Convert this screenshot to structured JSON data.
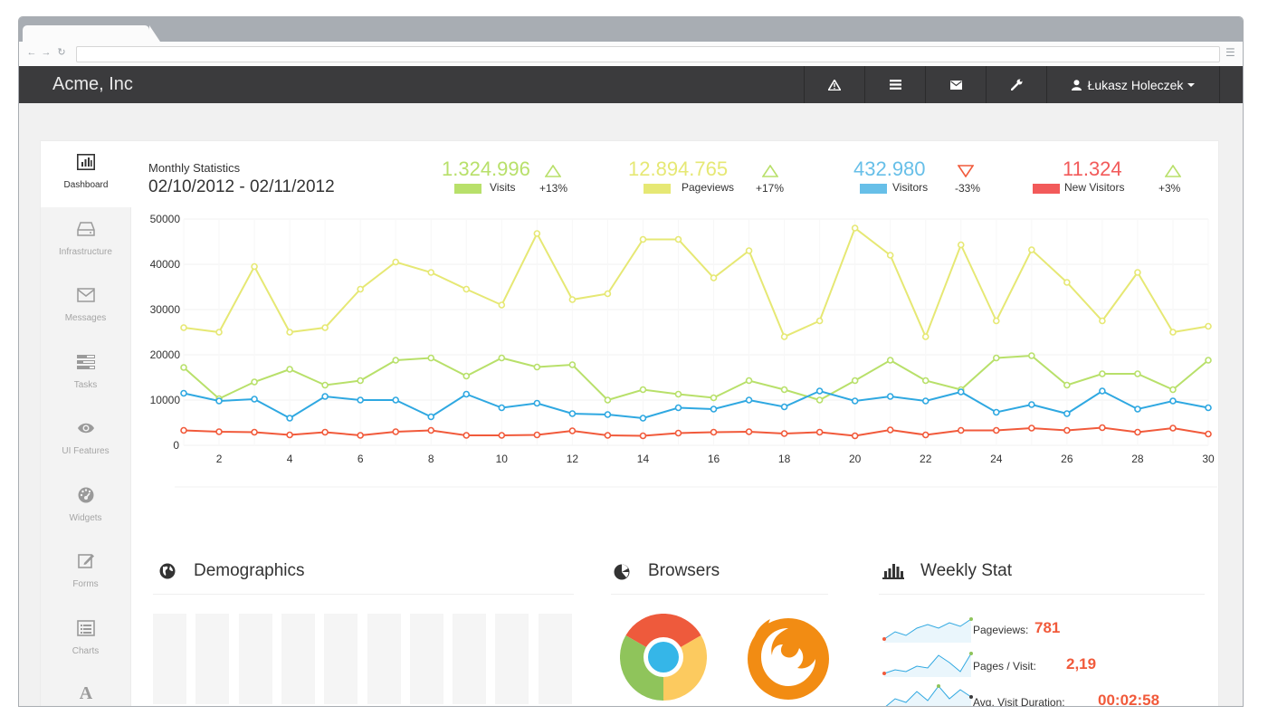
{
  "brand": "Acme, Inc",
  "user": {
    "name": "Łukasz Holeczek"
  },
  "nav_icons": [
    "warning-icon",
    "list-icon",
    "mail-icon",
    "wrench-icon"
  ],
  "sidebar": {
    "items": [
      {
        "label": "Dashboard",
        "icon": "bar-chart-icon",
        "active": true
      },
      {
        "label": "Infrastructure",
        "icon": "hdd-icon"
      },
      {
        "label": "Messages",
        "icon": "envelope-icon"
      },
      {
        "label": "Tasks",
        "icon": "tasks-icon"
      },
      {
        "label": "UI Features",
        "icon": "eye-icon"
      },
      {
        "label": "Widgets",
        "icon": "dashboard-icon"
      },
      {
        "label": "Forms",
        "icon": "edit-icon"
      },
      {
        "label": "Charts",
        "icon": "list-alt-icon"
      },
      {
        "label": "",
        "icon": "font-icon"
      }
    ]
  },
  "stats": {
    "title": "Monthly Statistics",
    "date_range": "02/10/2012 - 02/11/2012",
    "kpis": [
      {
        "value": "1.324.996",
        "label": "Visits",
        "change": "+13%",
        "trend": "up",
        "color": "#b8e06a"
      },
      {
        "value": "12.894.765",
        "label": "Pageviews",
        "change": "+17%",
        "trend": "up",
        "color": "#e6e874"
      },
      {
        "value": "432.980",
        "label": "Visitors",
        "change": "-33%",
        "trend": "down",
        "color": "#67bfe8"
      },
      {
        "value": "11.324",
        "label": "New Visitors",
        "change": "+3%",
        "trend": "up",
        "color": "#f25a5a"
      }
    ]
  },
  "chart_data": {
    "type": "line",
    "x": [
      1,
      2,
      3,
      4,
      5,
      6,
      7,
      8,
      9,
      10,
      11,
      12,
      13,
      14,
      15,
      16,
      17,
      18,
      19,
      20,
      21,
      22,
      23,
      24,
      25,
      26,
      27,
      28,
      29,
      30
    ],
    "x_tick_labels": [
      "2",
      "4",
      "6",
      "8",
      "10",
      "12",
      "14",
      "16",
      "18",
      "20",
      "22",
      "24",
      "26",
      "28",
      "30"
    ],
    "y_tick_labels": [
      "0",
      "10000",
      "20000",
      "30000",
      "40000",
      "50000"
    ],
    "ylim": [
      0,
      50000
    ],
    "grid": true,
    "series": [
      {
        "name": "Pageviews",
        "color": "#e6e874",
        "values": [
          26000,
          25000,
          39500,
          25000,
          26000,
          34500,
          40500,
          38200,
          34500,
          31000,
          46800,
          32200,
          33500,
          45500,
          45500,
          37000,
          43000,
          24000,
          27500,
          48000,
          42000,
          24000,
          44300,
          27500,
          43200,
          36000,
          27500,
          38200,
          25000,
          26300
        ]
      },
      {
        "name": "Visits",
        "color": "#b8e06a",
        "values": [
          17200,
          10300,
          14000,
          16800,
          13300,
          14300,
          18800,
          19300,
          15300,
          19300,
          17300,
          17800,
          10000,
          12300,
          11300,
          10500,
          14300,
          12300,
          10000,
          14300,
          18800,
          14300,
          12300,
          19300,
          19800,
          13300,
          15800,
          15800,
          12300,
          18800
        ]
      },
      {
        "name": "Visitors",
        "color": "#2fa8e1",
        "values": [
          11500,
          9800,
          10200,
          6000,
          10800,
          10000,
          10000,
          6300,
          11300,
          8300,
          9300,
          7000,
          6800,
          6000,
          8300,
          8000,
          10000,
          8500,
          12000,
          9800,
          10800,
          9800,
          11800,
          7300,
          9000,
          7000,
          12000,
          8000,
          9800,
          8300
        ]
      },
      {
        "name": "New Visitors",
        "color": "#f15a3b",
        "values": [
          3300,
          3000,
          2900,
          2300,
          2900,
          2200,
          3000,
          3300,
          2200,
          2200,
          2300,
          3200,
          2200,
          2100,
          2700,
          2900,
          3000,
          2600,
          2900,
          2100,
          3400,
          2300,
          3300,
          3300,
          3800,
          3300,
          3900,
          2900,
          3800,
          2500
        ]
      }
    ]
  },
  "sections": {
    "demographics": "Demographics",
    "browsers": "Browsers",
    "weekly": "Weekly Stat"
  },
  "weekly": [
    {
      "label": "Pageviews:",
      "value": "781",
      "spark_color": "#2fa8e1"
    },
    {
      "label": "Pages / Visit:",
      "value": "2,19",
      "spark_color": "#2fa8e1"
    },
    {
      "label": "Avg. Visit Duration:",
      "value": "00:02:58",
      "spark_color": "#2fa8e1"
    }
  ],
  "colors": {
    "accent": "#f15a3b",
    "nav_bg": "#3b3b3d"
  }
}
